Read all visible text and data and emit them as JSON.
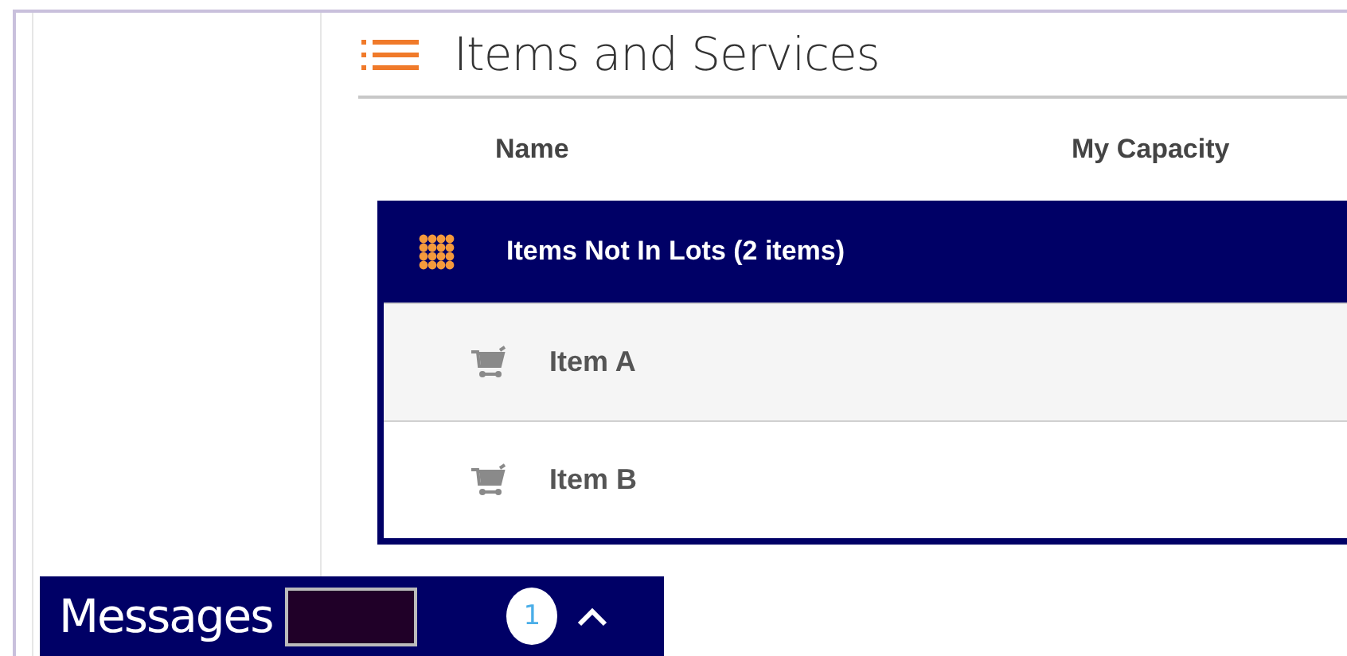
{
  "section": {
    "title": "Items and Services"
  },
  "table": {
    "columns": [
      "Name",
      "My Capacity"
    ],
    "group": {
      "label": "Items Not In Lots (2 items)"
    },
    "rows": [
      {
        "name": "Item A"
      },
      {
        "name": "Item B"
      }
    ]
  },
  "messages": {
    "title": "Messages",
    "count": "1"
  }
}
